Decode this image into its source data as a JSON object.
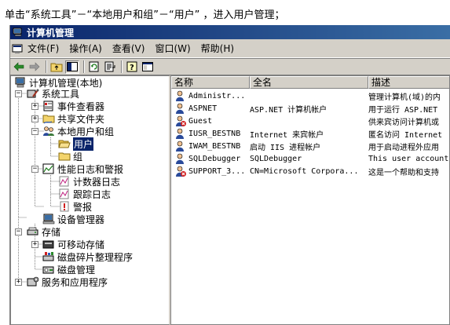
{
  "instruction": "单击“系统工具”－“本地用户和组”－“用户” ，进入用户管理；",
  "window": {
    "title": "计算机管理"
  },
  "menu": [
    {
      "label": "文件(F)"
    },
    {
      "label": "操作(A)"
    },
    {
      "label": "查看(V)"
    },
    {
      "label": "窗口(W)"
    },
    {
      "label": "帮助(H)"
    }
  ],
  "toolbar": {
    "buttons": [
      "back-icon",
      "forward-icon",
      "up-folder-icon",
      "show-tree-icon",
      "refresh-icon",
      "export-list-icon",
      "help-icon",
      "console-icon"
    ]
  },
  "tree": [
    {
      "label": "计算机管理(本地)",
      "icon": "computer-icon"
    },
    {
      "label": "系统工具",
      "icon": "tools-icon"
    },
    {
      "label": "事件查看器",
      "icon": "event-viewer-icon"
    },
    {
      "label": "共享文件夹",
      "icon": "shared-folder-icon"
    },
    {
      "label": "本地用户和组",
      "icon": "users-groups-icon"
    },
    {
      "label": "用户",
      "icon": "folder-open-icon",
      "selected": true
    },
    {
      "label": "组",
      "icon": "folder-icon"
    },
    {
      "label": "性能日志和警报",
      "icon": "performance-icon"
    },
    {
      "label": "计数器日志",
      "icon": "log-icon"
    },
    {
      "label": "跟踪日志",
      "icon": "log-icon"
    },
    {
      "label": "警报",
      "icon": "alert-icon"
    },
    {
      "label": "设备管理器",
      "icon": "device-manager-icon"
    },
    {
      "label": "存储",
      "icon": "storage-icon"
    },
    {
      "label": "可移动存储",
      "icon": "removable-storage-icon"
    },
    {
      "label": "磁盘碎片整理程序",
      "icon": "defrag-icon"
    },
    {
      "label": "磁盘管理",
      "icon": "disk-management-icon"
    },
    {
      "label": "服务和应用程序",
      "icon": "services-icon"
    }
  ],
  "list": {
    "columns": [
      "名称",
      "全名",
      "描述"
    ],
    "rows": [
      {
        "name": "Administr...",
        "fullname": "",
        "description": "管理计算机(域)的内",
        "disabled": false
      },
      {
        "name": "ASPNET",
        "fullname": "ASP.NET 计算机帐户",
        "description": "用于运行 ASP.NET",
        "disabled": false
      },
      {
        "name": "Guest",
        "fullname": "",
        "description": "供来宾访问计算机或",
        "disabled": true
      },
      {
        "name": "IUSR_BESTNB",
        "fullname": "Internet 来宾帐户",
        "description": "匿名访问 Internet",
        "disabled": false
      },
      {
        "name": "IWAM_BESTNB",
        "fullname": "启动 IIS 进程帐户",
        "description": "用于启动进程外应用",
        "disabled": false
      },
      {
        "name": "SQLDebugger",
        "fullname": "SQLDebugger",
        "description": "This user account",
        "disabled": false
      },
      {
        "name": "SUPPORT_3...",
        "fullname": "CN=Microsoft Corpora...",
        "description": "这是一个帮助和支持",
        "disabled": true
      }
    ]
  },
  "colors": {
    "titlebar": "#0a246a",
    "selection": "#0a246a",
    "chrome": "#d4d0c8"
  }
}
